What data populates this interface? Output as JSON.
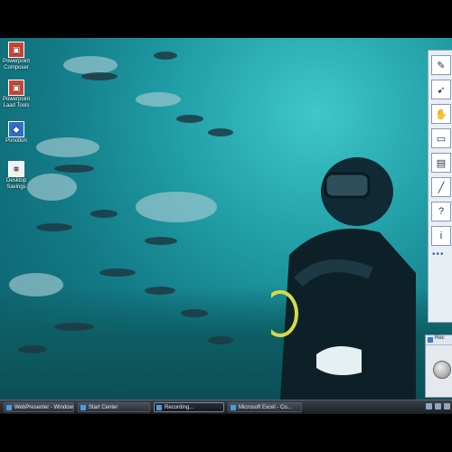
{
  "desktop_icons": [
    {
      "icon": "app-icon",
      "label": "Powerpoint\nComposer"
    },
    {
      "icon": "app-icon",
      "label": "Powerpoint\nLaad Tools"
    },
    {
      "icon": "app-icon",
      "label": "Ponotion"
    },
    {
      "icon": "document-icon",
      "label": "Desktop\nSavings"
    }
  ],
  "taskbar": {
    "tasks": [
      {
        "label": "WebPresenter - Windows...",
        "active": false
      },
      {
        "label": "Start Center",
        "active": false
      },
      {
        "label": "Recording...",
        "active": true
      },
      {
        "label": "Microsoft Excel - Co...",
        "active": false
      }
    ]
  },
  "toolbox": {
    "tools": [
      "pen-icon",
      "cursor-icon",
      "hand-icon",
      "eraser-icon",
      "clipboard-icon",
      "highlighter-icon",
      "help-icon",
      "info-icon"
    ],
    "more_label": "•••"
  },
  "mini_window": {
    "title": "Rec"
  }
}
